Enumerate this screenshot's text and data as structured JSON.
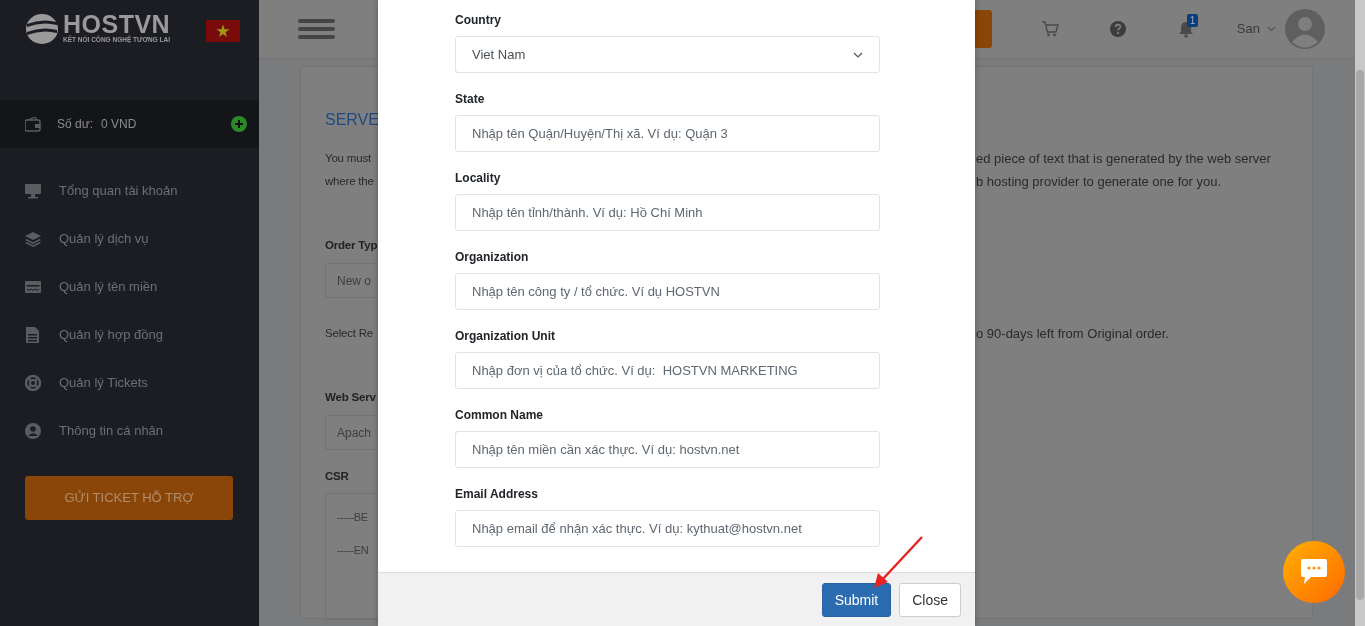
{
  "sidebar": {
    "logo": {
      "name": "HOSTVN",
      "tagline": "KẾT NỐI CÔNG NGHỆ TƯƠNG LAI"
    },
    "balance": {
      "label": "Số dư:",
      "value": "0 VND"
    },
    "menu": [
      {
        "label": "Tổng quan tài khoản"
      },
      {
        "label": "Quản lý dịch vụ"
      },
      {
        "label": "Quản lý tên miền"
      },
      {
        "label": "Quản lý hợp đồng"
      },
      {
        "label": "Quản lý Tickets"
      },
      {
        "label": "Thông tin cá nhân"
      }
    ],
    "support_button": "GỬI TICKET HỖ TRỢ"
  },
  "header": {
    "notification_count": "1",
    "user": "San"
  },
  "background": [
    {
      "kind": "title",
      "left": "SERVE"
    },
    {
      "kind": "text",
      "left": "You must",
      "right": "ed piece of text that is generated by the web server"
    },
    {
      "kind": "text",
      "left": "where the",
      "right": "b hosting provider to generate one for you."
    },
    {
      "kind": "label",
      "left": "Order Typ"
    },
    {
      "kind": "field",
      "left": "New o"
    },
    {
      "kind": "text",
      "left": "Select Re",
      "right": "o 90-days left from Original order."
    },
    {
      "kind": "label",
      "left": "Web Serv"
    },
    {
      "kind": "field",
      "left": "Apach"
    },
    {
      "kind": "label",
      "left": "CSR"
    },
    {
      "kind": "textarea",
      "lines": [
        "-----BE",
        "-----EN"
      ]
    }
  ],
  "modal": {
    "fields": [
      {
        "kind": "select",
        "label": "Country",
        "value": "Viet Nam"
      },
      {
        "kind": "input",
        "label": "State",
        "placeholder": "Nhập tên Quận/Huyện/Thị xã. Ví dụ: Quận 3"
      },
      {
        "kind": "input",
        "label": "Locality",
        "placeholder": "Nhập tên tỉnh/thành. Ví dụ: Hồ Chí Minh"
      },
      {
        "kind": "input",
        "label": "Organization",
        "placeholder": "Nhập tên công ty / tổ chức. Ví dụ HOSTVN"
      },
      {
        "kind": "input",
        "label": "Organization Unit",
        "placeholder": "Nhập đơn vị của tổ chức. Ví dụ:  HOSTVN MARKETING"
      },
      {
        "kind": "input",
        "label": "Common Name",
        "placeholder": "Nhập tên miền cần xác thực. Ví dụ: hostvn.net"
      },
      {
        "kind": "input",
        "label": "Email Address",
        "placeholder": "Nhập email để nhận xác thực. Ví dụ: kythuat@hostvn.net"
      }
    ],
    "buttons": [
      {
        "kind": "primary",
        "label": "Submit"
      },
      {
        "kind": "secondary",
        "label": "Close"
      }
    ]
  },
  "annotations": [
    {
      "kind": "arrow"
    }
  ]
}
